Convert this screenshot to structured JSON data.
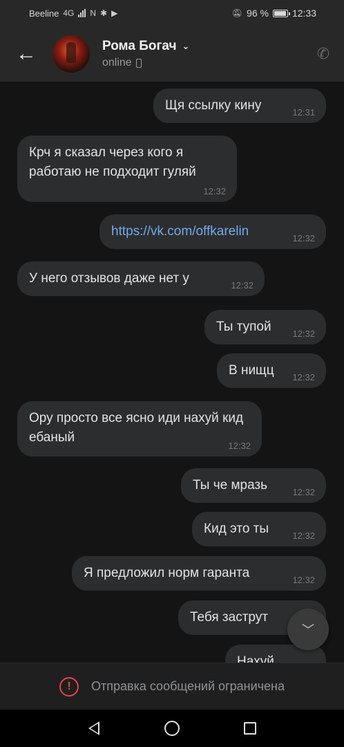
{
  "status_bar": {
    "carrier": "Beeline",
    "network": "4G",
    "battery": "96 %",
    "time": "12:33",
    "battery_level": 0.96
  },
  "header": {
    "contact_name": "Рома Богач",
    "contact_status": "online",
    "back_icon": "arrow-left-icon",
    "call_icon": "phone-icon"
  },
  "messages": [
    {
      "side": "out",
      "text": "Щя ссылку кину",
      "time": "12:31"
    },
    {
      "side": "in",
      "text": "Крч я сказал через кого я работаю не подходит гуляй",
      "time": "12:32"
    },
    {
      "side": "out",
      "text": "https://vk.com/offkarelin",
      "time": "12:32",
      "link": true
    },
    {
      "side": "in",
      "text": "У него отзывов даже нет у",
      "time": "12:32"
    },
    {
      "side": "out",
      "text": "Ты тупой",
      "time": "12:32"
    },
    {
      "side": "out",
      "text": "В нищц",
      "time": "12:32"
    },
    {
      "side": "in",
      "text": "Ору просто все ясно иди нахуй кид ебаный",
      "time": "12:32"
    },
    {
      "side": "out",
      "text": "Ты че мразь",
      "time": "12:32"
    },
    {
      "side": "out",
      "text": "Кид это ты",
      "time": "12:32"
    },
    {
      "side": "out",
      "text": "Я предложил норм гаранта",
      "time": "12:32"
    },
    {
      "side": "out",
      "text": "Тебя заструт",
      "time": ""
    },
    {
      "side": "out",
      "text": "Нахуй",
      "time": ""
    }
  ],
  "restriction": {
    "text": "Отправка сообщений ограничена",
    "icon": "warning-icon",
    "color": "#e64646"
  },
  "nav": {
    "back_icon": "nav-back-icon",
    "home_icon": "nav-home-icon",
    "recent_icon": "nav-recent-icon"
  },
  "scroll_down_icon": "chevron-down-icon",
  "colors": {
    "background": "#141414",
    "bubble": "#2c2d2e",
    "link": "#71aaeb"
  }
}
